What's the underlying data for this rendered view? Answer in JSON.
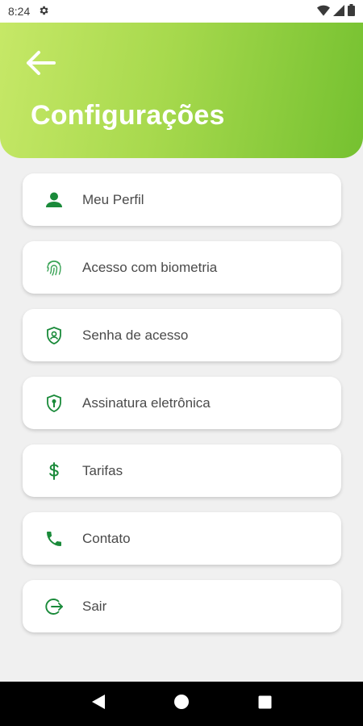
{
  "status_bar": {
    "time": "8:24",
    "icons": [
      "gear-icon",
      "wifi-icon",
      "signal-icon",
      "battery-icon"
    ]
  },
  "header": {
    "title": "Configurações",
    "back_icon": "arrow-left-icon"
  },
  "menu": {
    "items": [
      {
        "label": "Meu Perfil",
        "icon": "person-icon"
      },
      {
        "label": "Acesso com biometria",
        "icon": "fingerprint-icon"
      },
      {
        "label": "Senha de acesso",
        "icon": "shield-user-icon"
      },
      {
        "label": "Assinatura eletrônica",
        "icon": "shield-key-icon"
      },
      {
        "label": "Tarifas",
        "icon": "dollar-icon"
      },
      {
        "label": "Contato",
        "icon": "phone-icon"
      },
      {
        "label": "Sair",
        "icon": "logout-icon"
      }
    ]
  },
  "nav_bar": {
    "icons": [
      "back-triangle-icon",
      "home-circle-icon",
      "recents-square-icon"
    ]
  },
  "colors": {
    "accent_green": "#1a8a3a",
    "header_gradient_start": "#c6e867",
    "header_gradient_end": "#75c130",
    "background": "#f0f0f0"
  }
}
